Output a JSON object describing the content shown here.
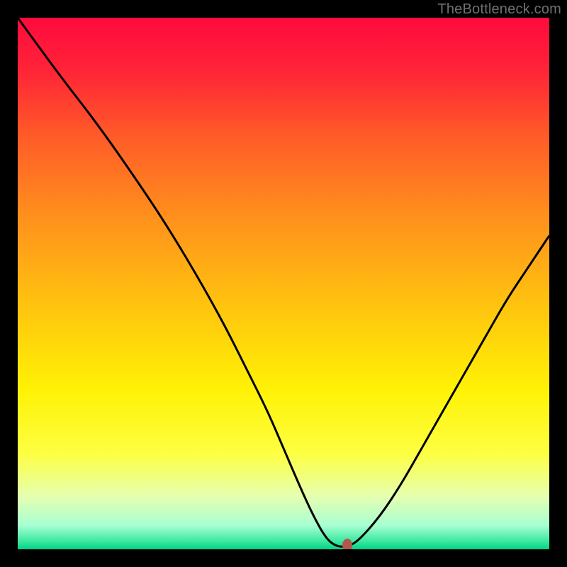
{
  "watermark": "TheBottleneck.com",
  "colors": {
    "frame": "#000000",
    "curve_stroke": "#000000",
    "marker_fill": "#b1574b",
    "gradient_stops": [
      {
        "offset": 0.0,
        "color": "#ff0a3e"
      },
      {
        "offset": 0.1,
        "color": "#ff2437"
      },
      {
        "offset": 0.22,
        "color": "#ff5a28"
      },
      {
        "offset": 0.38,
        "color": "#ff921c"
      },
      {
        "offset": 0.55,
        "color": "#ffc60e"
      },
      {
        "offset": 0.7,
        "color": "#fff205"
      },
      {
        "offset": 0.82,
        "color": "#fdff42"
      },
      {
        "offset": 0.9,
        "color": "#e6ffb0"
      },
      {
        "offset": 0.955,
        "color": "#a7ffd2"
      },
      {
        "offset": 0.985,
        "color": "#3be8a1"
      },
      {
        "offset": 1.0,
        "color": "#00d486"
      }
    ]
  },
  "chart_data": {
    "type": "line",
    "title": "",
    "xlabel": "",
    "ylabel": "",
    "xlim": [
      0,
      100
    ],
    "ylim": [
      0,
      100
    ],
    "series": [
      {
        "name": "bottleneck-curve",
        "x": [
          0,
          8,
          15,
          22,
          28,
          34,
          39,
          43,
          47,
          50,
          53,
          55.5,
          58,
          60,
          62,
          64,
          68,
          72,
          76,
          80,
          84,
          88,
          92,
          96,
          100
        ],
        "y": [
          100,
          89,
          80,
          70,
          61,
          51,
          42,
          34,
          26,
          19,
          12,
          6.5,
          2,
          0.5,
          0.5,
          1.5,
          6,
          12,
          19,
          26,
          33,
          40,
          47,
          53,
          59
        ]
      }
    ],
    "marker": {
      "x": 62,
      "y": 0.8
    }
  }
}
